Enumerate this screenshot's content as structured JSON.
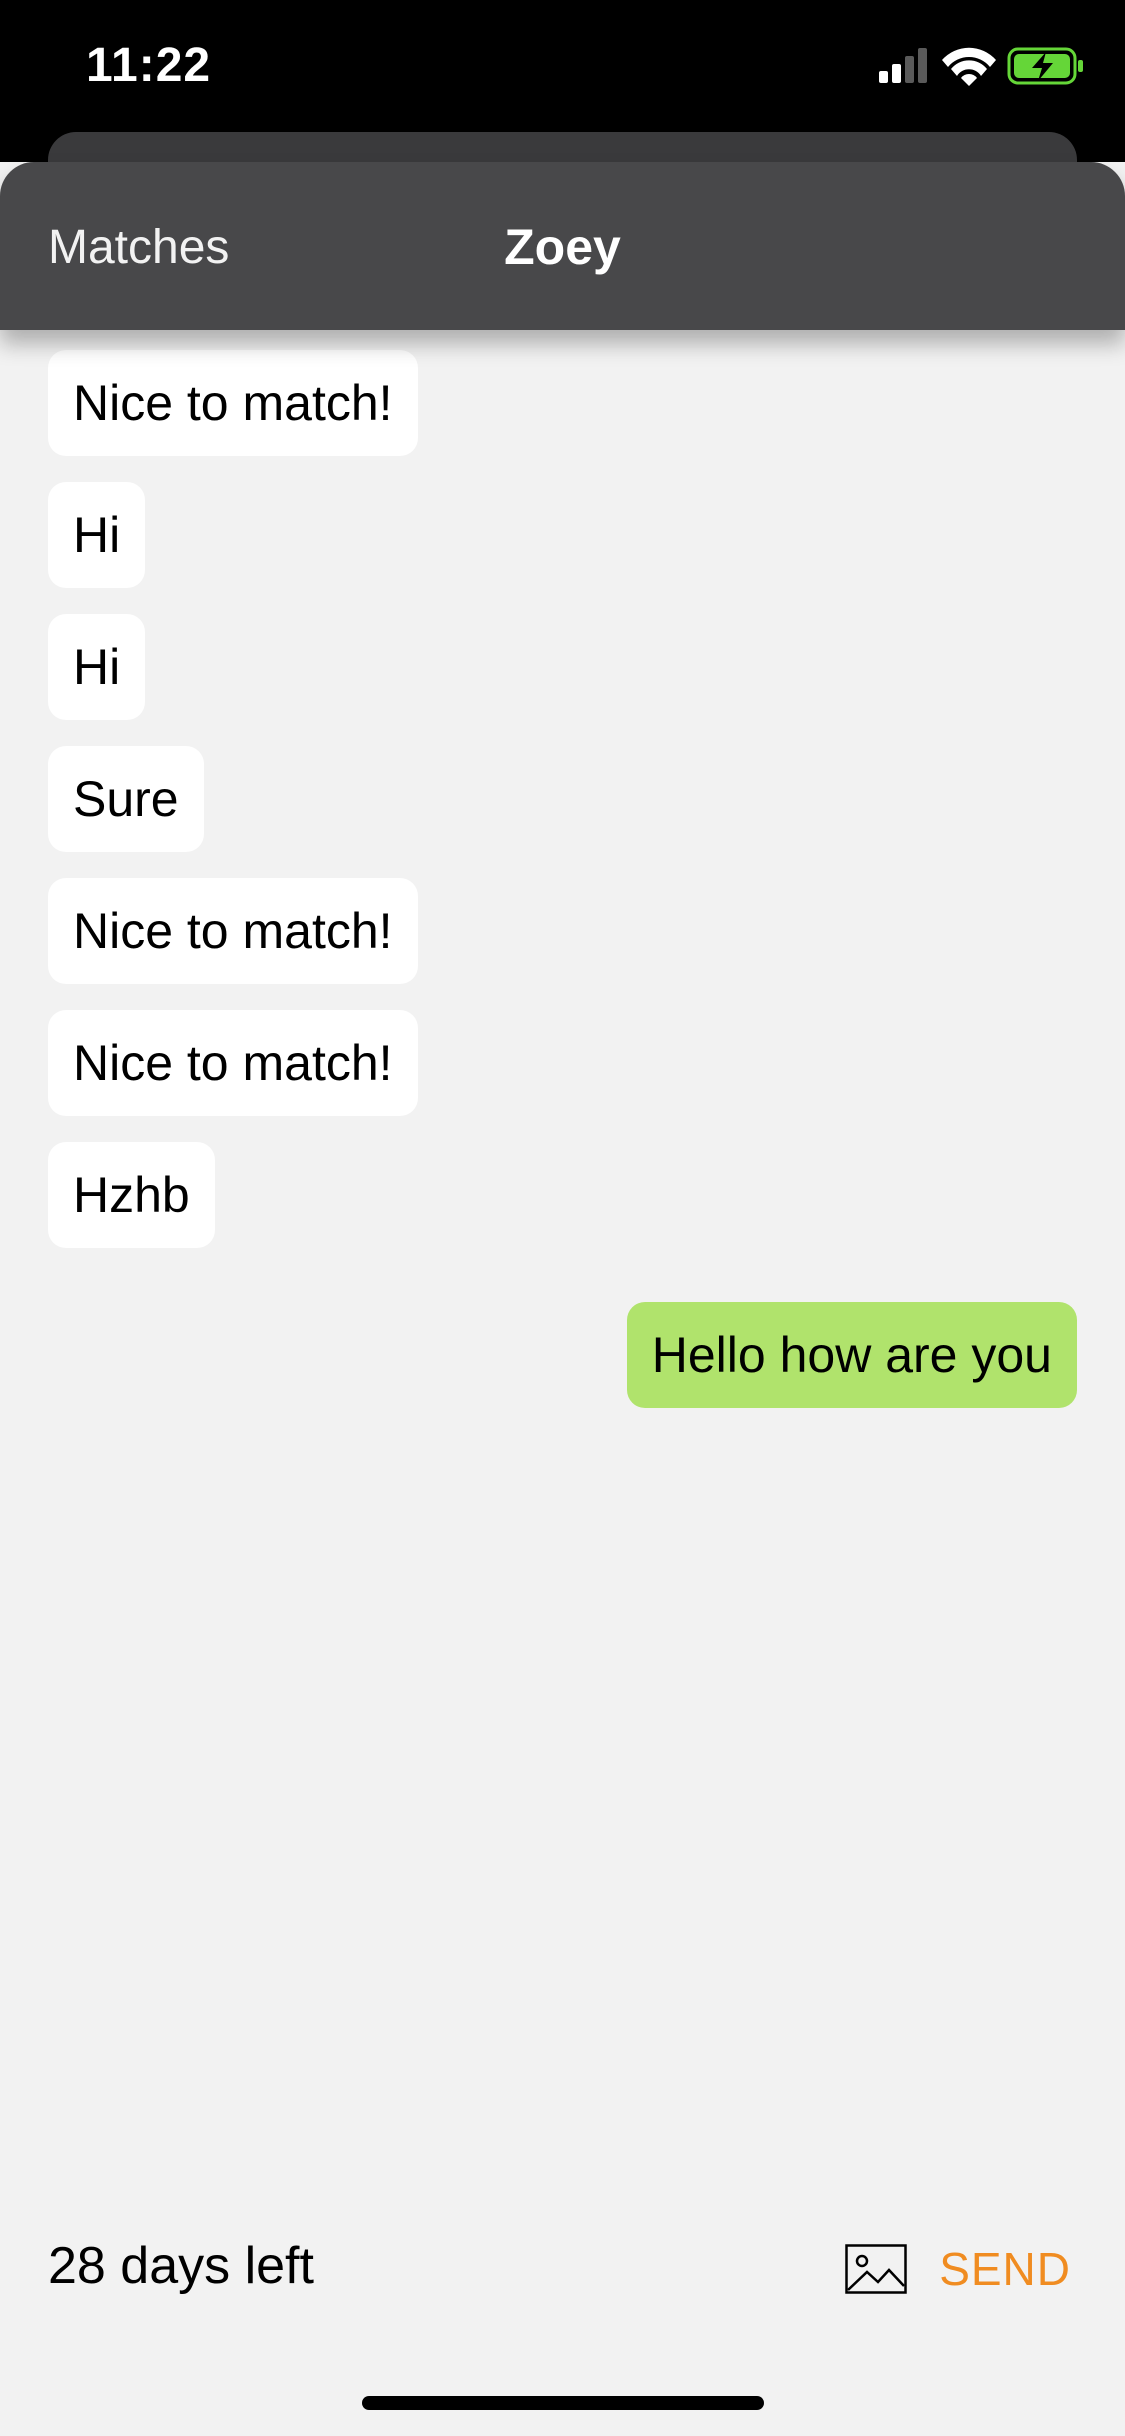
{
  "status_bar": {
    "time": "11:22",
    "icons": [
      "signal-icon",
      "wifi-icon",
      "battery-charging-icon"
    ]
  },
  "nav": {
    "back_label": "Matches",
    "title": "Zoey"
  },
  "messages": [
    {
      "text": "Nice to match!",
      "direction": "incoming"
    },
    {
      "text": "Hi",
      "direction": "incoming"
    },
    {
      "text": "Hi",
      "direction": "incoming"
    },
    {
      "text": "Sure",
      "direction": "incoming"
    },
    {
      "text": "Nice to match!",
      "direction": "incoming"
    },
    {
      "text": "Nice to match!",
      "direction": "incoming"
    },
    {
      "text": "Hzhb",
      "direction": "incoming"
    },
    {
      "text": "Hello how are you",
      "direction": "outgoing"
    }
  ],
  "composer": {
    "days_left": "28 days left",
    "image_icon": "image-icon",
    "send_label": "SEND"
  },
  "colors": {
    "outgoing_bubble": "#b0e36c",
    "incoming_bubble": "#ffffff",
    "accent": "#f08c21",
    "nav_background": "#48484a",
    "battery": "#65d638"
  }
}
